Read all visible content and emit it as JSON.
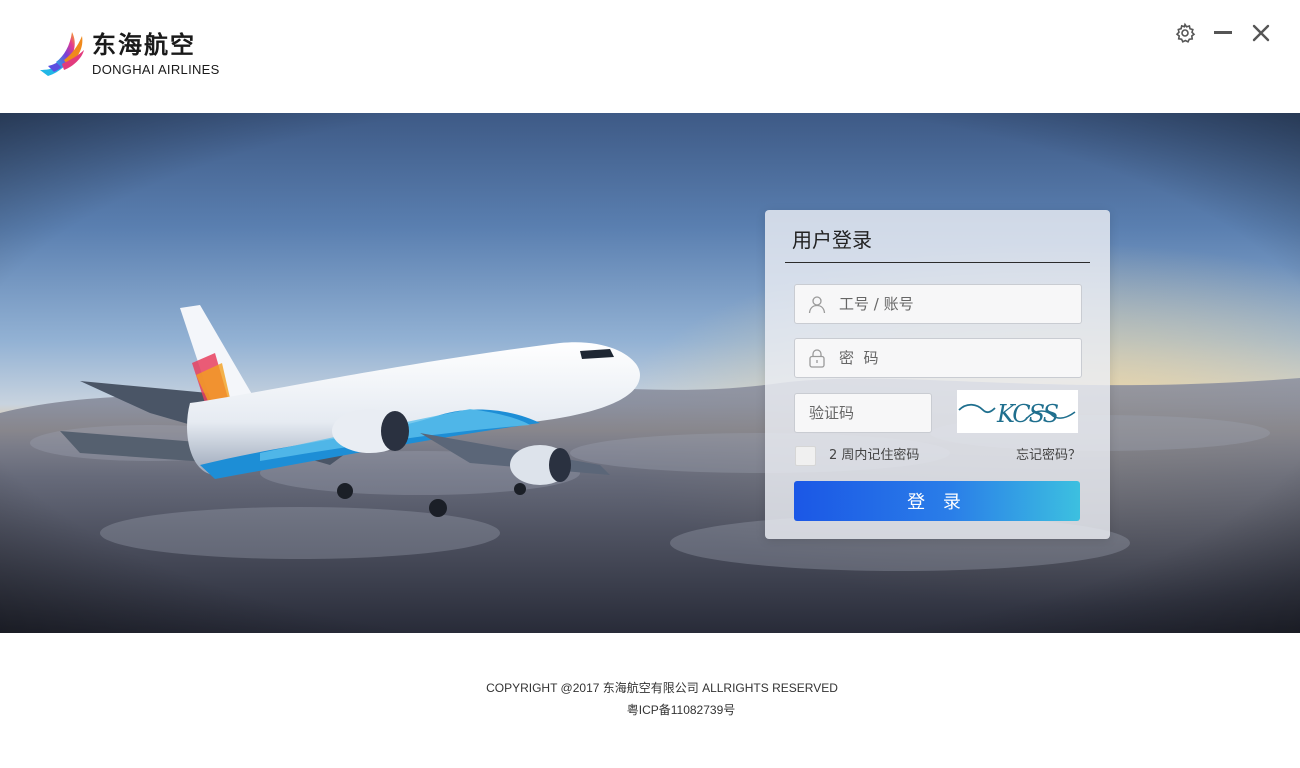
{
  "brand": {
    "name_cn": "东海航空",
    "name_en": "DONGHAI AIRLINES"
  },
  "window_controls": {
    "settings_icon": "gear-icon",
    "minimize_icon": "minus-icon",
    "close_icon": "close-icon"
  },
  "login": {
    "title": "用户登录",
    "account_placeholder": "工号 / 账号",
    "password_placeholder": "密  码",
    "captcha_placeholder": "验证码",
    "captcha_text": "KCSS",
    "remember_label": "2 周内记住密码",
    "forgot_label": "忘记密码？",
    "submit_label": "登 录"
  },
  "footer": {
    "copyright": "COPYRIGHT @2017 东海航空有限公司 ALLRIGHTS RESERVED",
    "icp": "粤ICP备11082739号"
  },
  "colors": {
    "button_start": "#1b57e6",
    "button_end": "#3cc0e0",
    "panel_bg": "#ebeef4"
  }
}
